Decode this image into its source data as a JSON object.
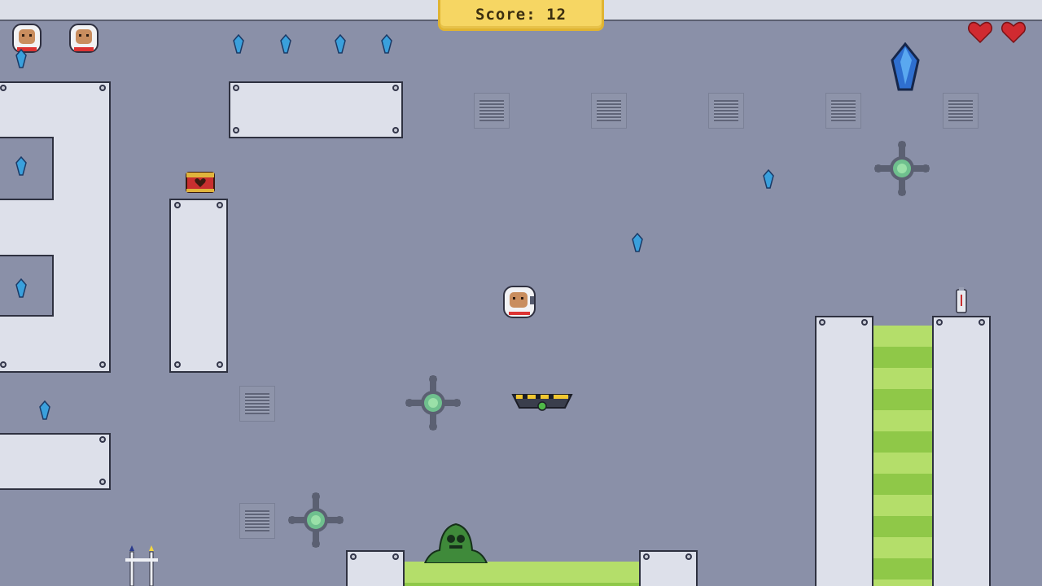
{
  "hud": {
    "score_label": "Score:",
    "score_value": "12",
    "lives": 2,
    "extra_lives_icons": 2
  },
  "colors": {
    "background": "#8a90a8",
    "panel": "#dde0ea",
    "score_badge": "#f6d663",
    "slime": "#b4de6a",
    "gem": "#3aa0dc",
    "heart": "#d02a30"
  },
  "entities": {
    "player": "astronaut",
    "enemy": "green-slime-monster",
    "platform": "hover-platform",
    "chest": "treasure-chest",
    "big_gem": "large-blue-crystal"
  }
}
